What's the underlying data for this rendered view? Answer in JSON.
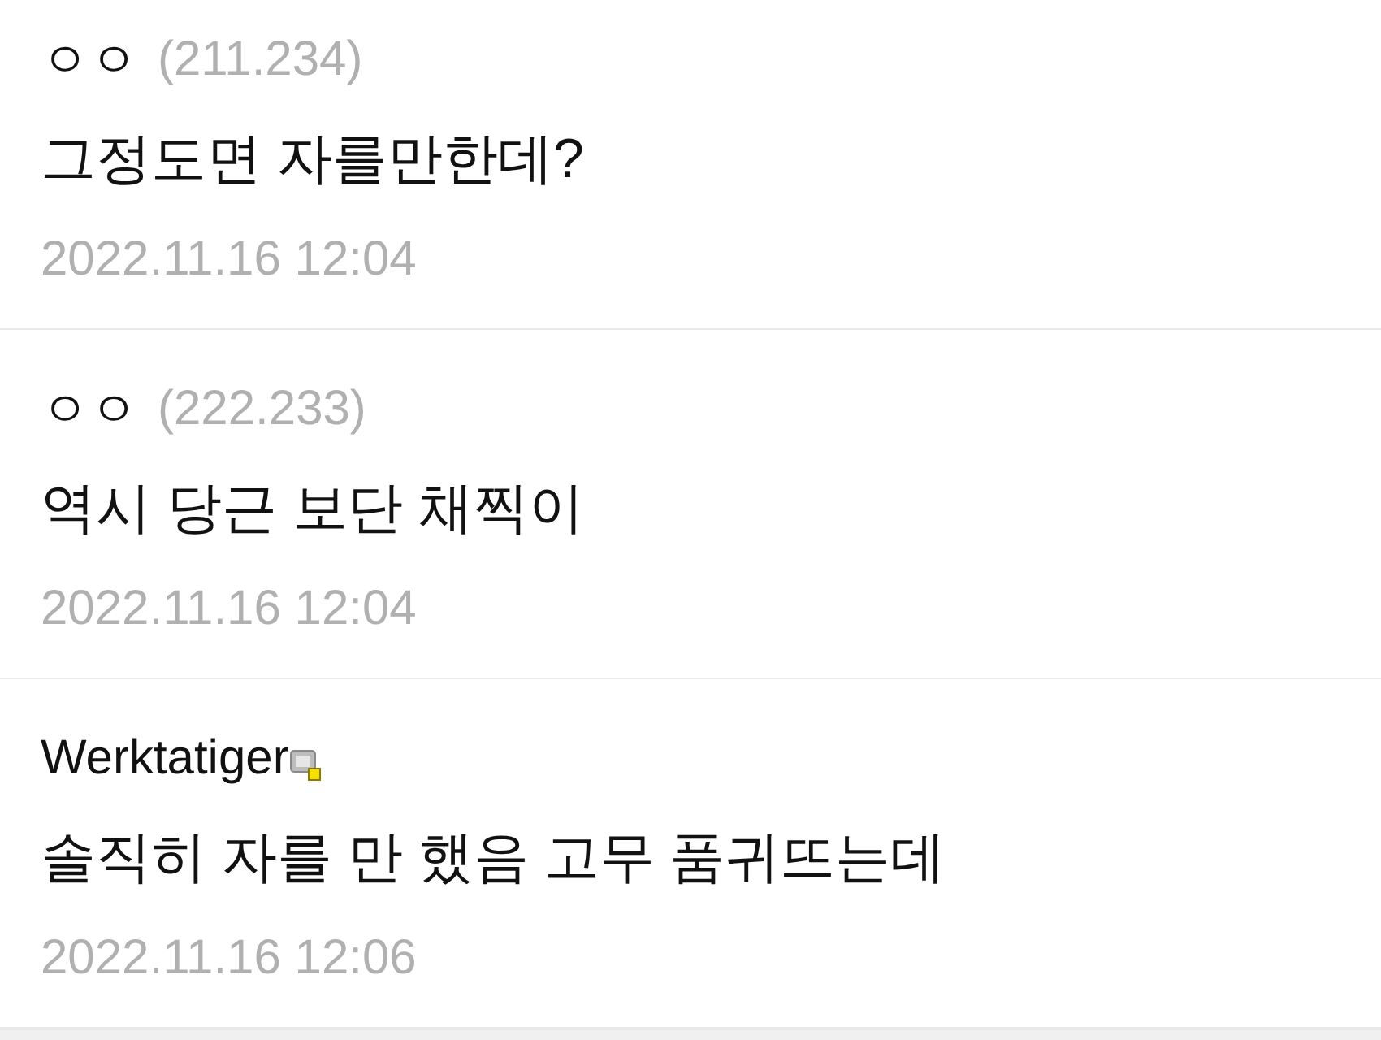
{
  "comments": [
    {
      "author": "ㅇㅇ",
      "ip": "(211.234)",
      "fixed_nick": false,
      "text": "그정도면 자를만한데?",
      "date": "2022.11.16 12:04"
    },
    {
      "author": "ㅇㅇ",
      "ip": "(222.233)",
      "fixed_nick": false,
      "text": "역시 당근 보단 채찍이",
      "date": "2022.11.16 12:04"
    },
    {
      "author": "Werktatiger",
      "fixed_nick": true,
      "text": "솔직히 자를 만 했음 고무 품귀뜨는데",
      "date": "2022.11.16 12:06"
    }
  ]
}
